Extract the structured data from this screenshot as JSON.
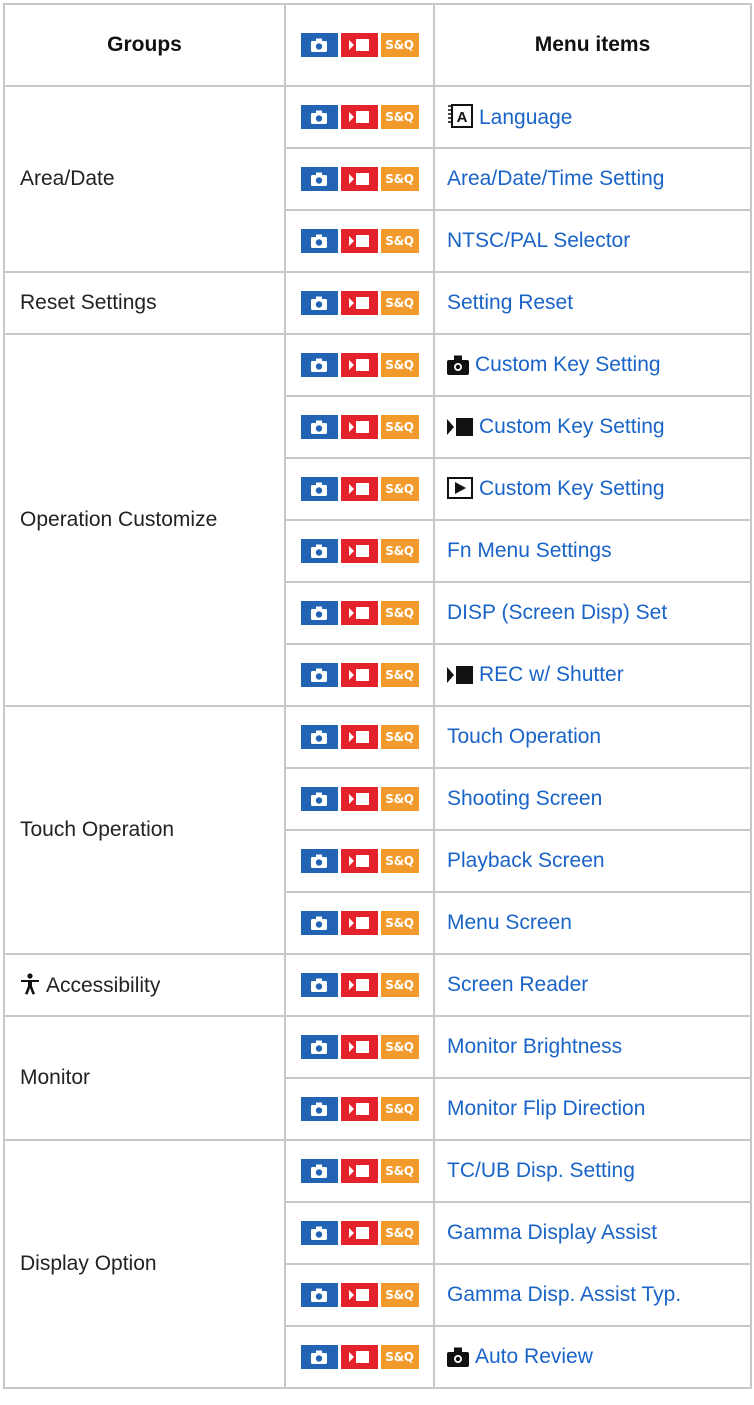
{
  "header": {
    "groups": "Groups",
    "mode_labels": {
      "photo": "",
      "movie": "",
      "sq": "S&Q"
    },
    "menu_items": "Menu items"
  },
  "colors": {
    "link": "#1a64c8",
    "photo_badge": "#2263b4",
    "movie_badge": "#e3222c",
    "sq_badge": "#f39a2c",
    "border": "#c8c8c8"
  },
  "groups": [
    {
      "label": "Area/Date",
      "items": [
        {
          "label": "Language",
          "icon": "language-icon"
        },
        {
          "label": "Area/Date/Time Setting",
          "icon": ""
        },
        {
          "label": "NTSC/PAL Selector",
          "icon": ""
        }
      ]
    },
    {
      "label": "Reset Settings",
      "items": [
        {
          "label": "Setting Reset",
          "icon": ""
        }
      ]
    },
    {
      "label": "Operation Customize",
      "items": [
        {
          "label": "Custom Key Setting",
          "icon": "camera-icon"
        },
        {
          "label": "Custom Key Setting",
          "icon": "movie-icon"
        },
        {
          "label": "Custom Key Setting",
          "icon": "playback-icon"
        },
        {
          "label": "Fn Menu Settings",
          "icon": ""
        },
        {
          "label": "DISP (Screen Disp) Set",
          "icon": ""
        },
        {
          "label": "REC w/ Shutter",
          "icon": "movie-icon"
        }
      ]
    },
    {
      "label": "Touch Operation",
      "items": [
        {
          "label": "Touch Operation",
          "icon": ""
        },
        {
          "label": "Shooting Screen",
          "icon": ""
        },
        {
          "label": "Playback Screen",
          "icon": ""
        },
        {
          "label": "Menu Screen",
          "icon": ""
        }
      ]
    },
    {
      "label": "Accessibility",
      "icon": "accessibility-icon",
      "items": [
        {
          "label": "Screen Reader",
          "icon": ""
        }
      ]
    },
    {
      "label": "Monitor",
      "items": [
        {
          "label": "Monitor Brightness",
          "icon": ""
        },
        {
          "label": "Monitor Flip Direction",
          "icon": ""
        }
      ]
    },
    {
      "label": "Display Option",
      "items": [
        {
          "label": "TC/UB Disp. Setting",
          "icon": ""
        },
        {
          "label": "Gamma Display Assist",
          "icon": ""
        },
        {
          "label": "Gamma Disp. Assist Typ.",
          "icon": ""
        },
        {
          "label": "Auto Review",
          "icon": "camera-icon"
        }
      ]
    }
  ]
}
